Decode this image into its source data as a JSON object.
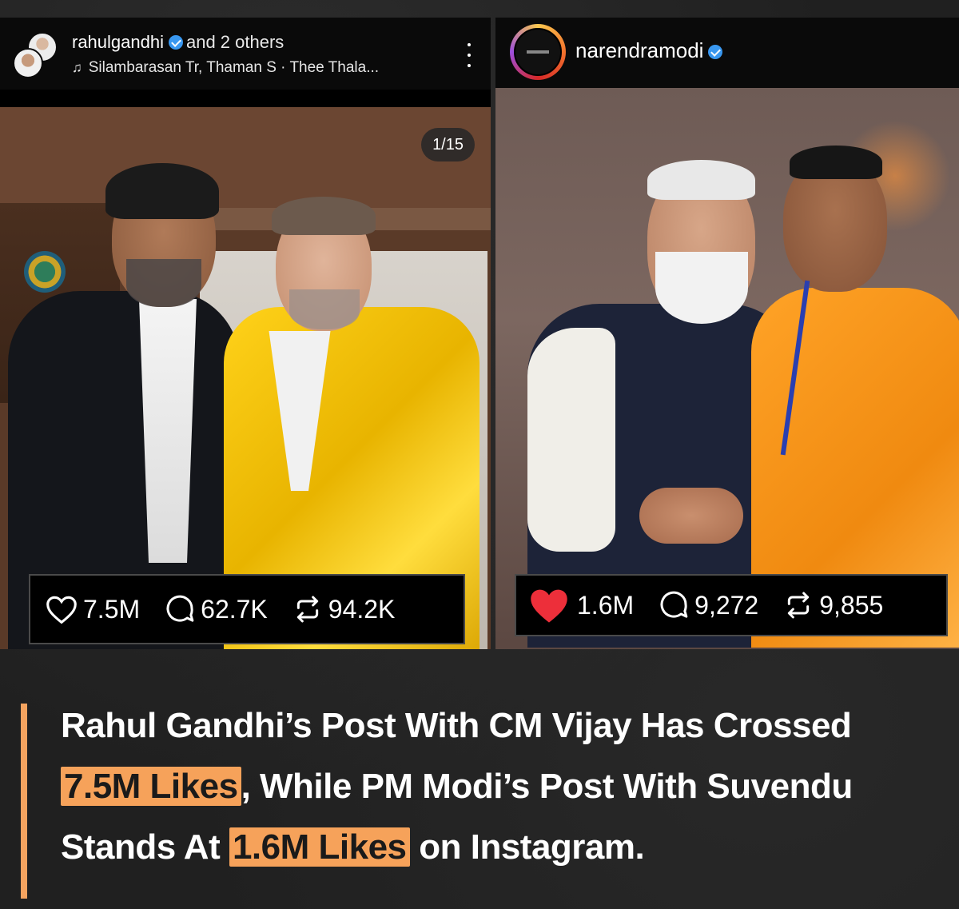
{
  "left_post": {
    "username": "rahulgandhi",
    "collab": "and 2 others",
    "music": "Silambarasan Tr, Thaman S · Thee Thala...",
    "counter": "1/15",
    "stats": {
      "likes": "7.5M",
      "comments": "62.7K",
      "reposts": "94.2K"
    }
  },
  "right_post": {
    "username": "narendramodi",
    "stats": {
      "likes": "1.6M",
      "comments": "9,272",
      "reposts": "9,855"
    }
  },
  "caption": {
    "line1": "Rahul Gandhi’s Post With CM Vijay Has Crossed",
    "hl1": "7.5M Likes",
    "line2": ", While PM Modi’s Post With Suvendu",
    "line3_pre": "Stands At ",
    "hl2": "1.6M Likes",
    "line3_post": " on Instagram."
  },
  "colors": {
    "accent": "#f6a25a",
    "heart_filled": "#ed2f3a",
    "verified": "#3897f0"
  },
  "icons": [
    "verified-badge-icon",
    "music-note-icon",
    "more-icon",
    "heart-icon",
    "comment-icon",
    "repost-icon"
  ]
}
